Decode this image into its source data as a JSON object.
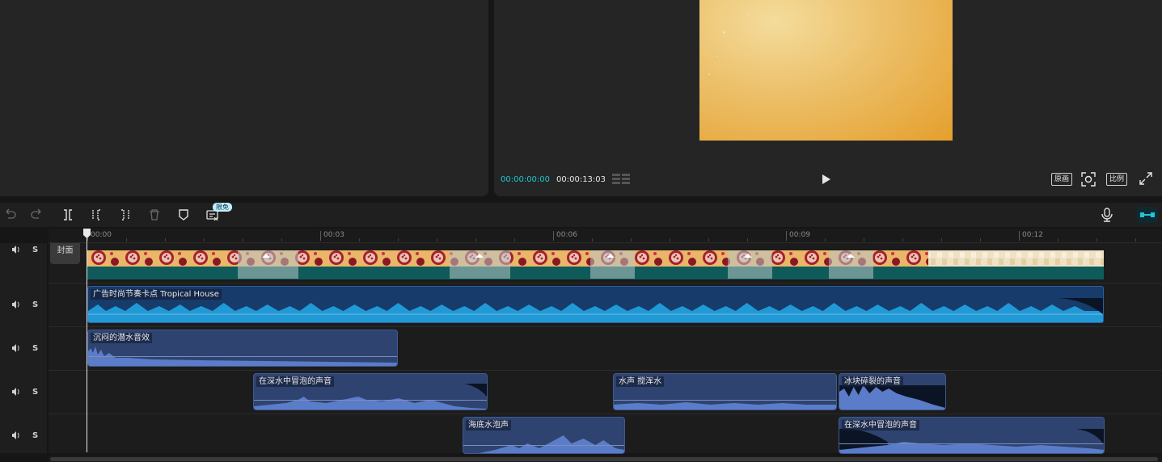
{
  "preview": {
    "current_time": "00:00:00:00",
    "total_time": "00:00:13:03",
    "original_label": "原画",
    "ratio_label": "比例"
  },
  "toolbar": {
    "badge_free": "限免",
    "icons": [
      "undo-icon",
      "redo-icon",
      "split-icon",
      "split-left-icon",
      "split-right-icon",
      "delete-icon",
      "marker-icon",
      "captions-icon",
      "mic-icon",
      "link-toggle-icon"
    ]
  },
  "ruler": {
    "ticks": [
      "00:00",
      "00:03",
      "00:06",
      "00:09",
      "00:12"
    ]
  },
  "cover": {
    "label": "封面"
  },
  "tracks": [
    {
      "s_label": "S"
    },
    {
      "s_label": "S"
    },
    {
      "s_label": "S"
    },
    {
      "s_label": "S"
    },
    {
      "s_label": "S"
    }
  ],
  "clips": {
    "music": {
      "label": "广告时尚节奏卡点  Tropical House"
    },
    "a1": {
      "label": "沉闷的潜水音效"
    },
    "a2": {
      "label": "在深水中冒泡的声音"
    },
    "a3": {
      "label": "水声 搅浑水"
    },
    "a4": {
      "label": "冰块碎裂的声音"
    },
    "a5": {
      "label": "海底水泡声"
    },
    "a6": {
      "label": "在深水中冒泡的声音"
    }
  },
  "colors": {
    "accent": "#1fc6d4",
    "audio_clip": "#2e4370",
    "music_clip": "#173b6a",
    "video_bar": "#0f5a5a"
  }
}
